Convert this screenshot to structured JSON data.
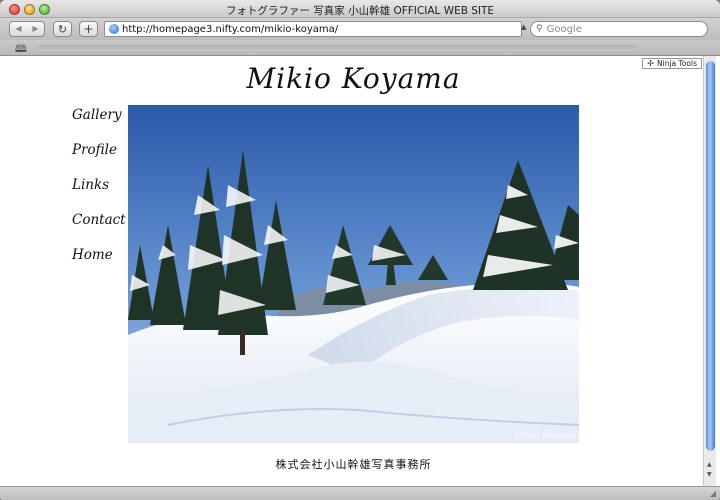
{
  "window": {
    "title": "フォトグラファー 写真家 小山幹雄 OFFICIAL WEB SITE"
  },
  "toolbar": {
    "back_icon": "back-arrow-icon",
    "forward_icon": "forward-arrow-icon",
    "reload_glyph": "↻",
    "add_glyph": "+",
    "url": "http://homepage3.nifty.com/mikio-koyama/",
    "search_placeholder": "Google"
  },
  "extension": {
    "label": "Ninja Tools"
  },
  "site": {
    "title": "Mikio Koyama",
    "nav": [
      "Gallery",
      "Profile",
      "Links",
      "Contact",
      "Home"
    ],
    "photo_caption": "Mikio Koyama",
    "footer": "株式会社小山幹雄写真事務所"
  },
  "colors": {
    "sky": "#2e5fb0",
    "snow": "#f4f7fb",
    "tree": "#1f3326",
    "scroll_thumb": "#5c8fd8"
  }
}
